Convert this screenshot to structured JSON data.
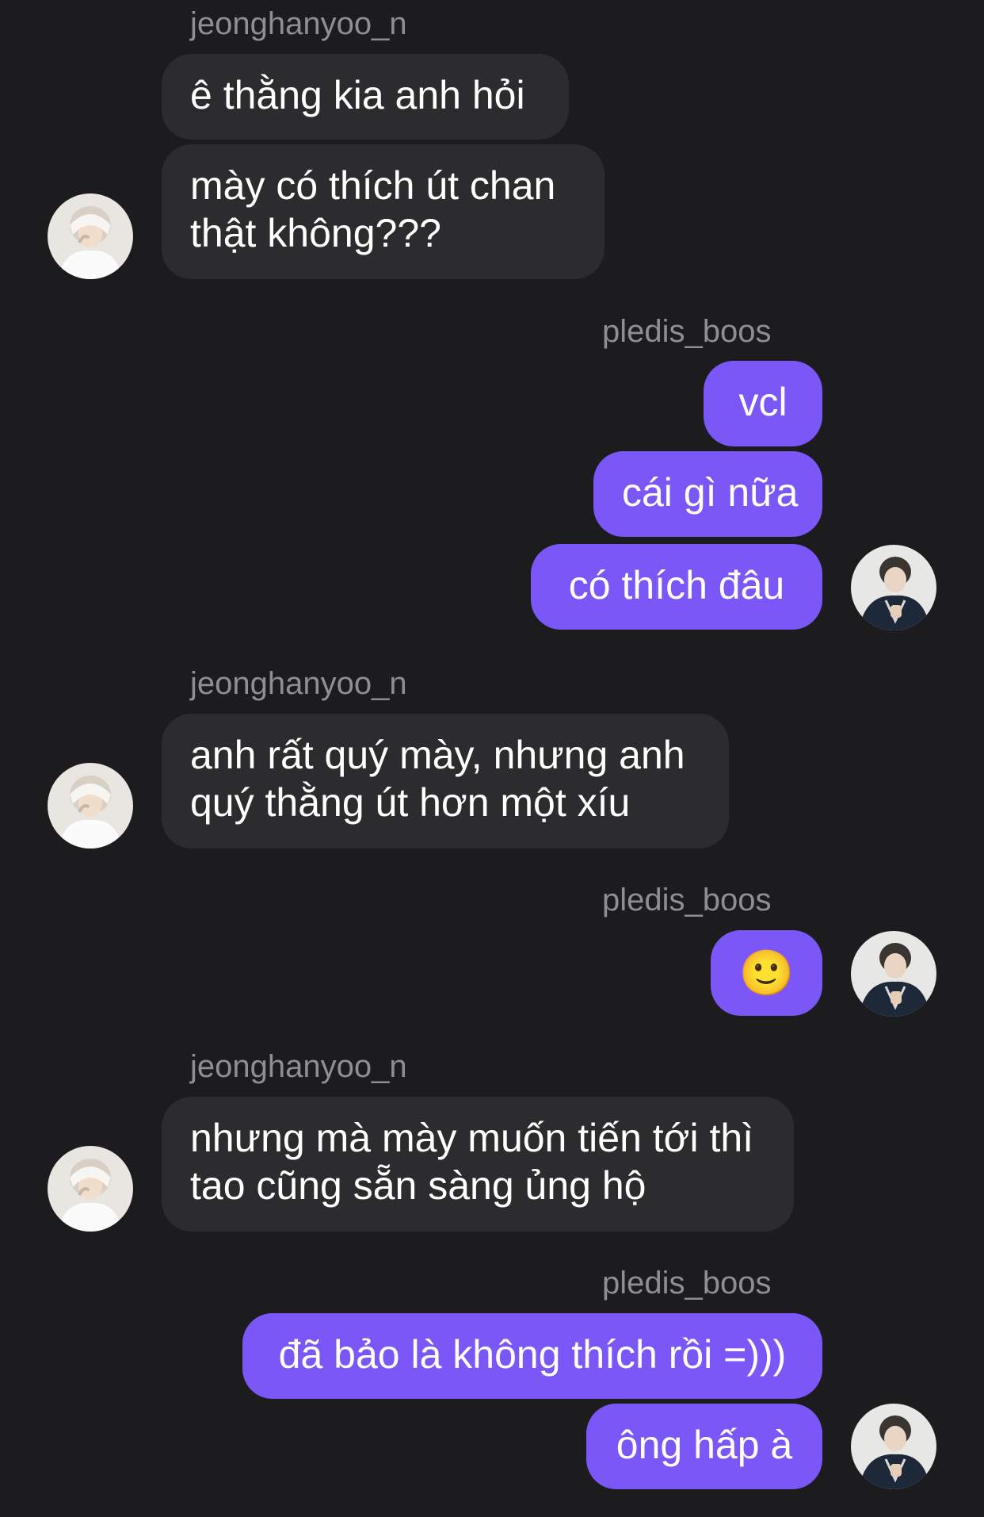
{
  "participants": {
    "other": {
      "username": "jeonghanyoo_n",
      "avatar_icon": "avatar-white-hood-person-icon"
    },
    "self": {
      "username": "pledis_boos",
      "avatar_icon": "avatar-dark-jacket-person-icon"
    }
  },
  "groups": [
    {
      "sender": "jeonghanyoo_n",
      "messages": [
        {
          "text": "ê thằng kia anh hỏi"
        },
        {
          "lines": [
            "mày có thích út chan",
            "thật không???"
          ]
        }
      ]
    },
    {
      "sender": "pledis_boos",
      "messages": [
        {
          "text": "vcl"
        },
        {
          "text": "cái gì nữa"
        },
        {
          "text": "có thích đâu"
        }
      ]
    },
    {
      "sender": "jeonghanyoo_n",
      "messages": [
        {
          "lines": [
            "anh rất quý mày, nhưng anh",
            "quý thằng út hơn một xíu"
          ]
        }
      ]
    },
    {
      "sender": "pledis_boos",
      "messages": [
        {
          "emoji": "🙂",
          "emoji_name": "slightly-smiling-face-emoji"
        }
      ]
    },
    {
      "sender": "jeonghanyoo_n",
      "messages": [
        {
          "lines": [
            "nhưng mà mày muốn tiến tới thì",
            "tao cũng sẵn sàng ủng hộ"
          ]
        }
      ]
    },
    {
      "sender": "pledis_boos",
      "messages": [
        {
          "text": "đã bảo là không thích rồi =)))"
        },
        {
          "text": "ông hấp à"
        }
      ]
    }
  ],
  "colors": {
    "background": "#1c1c1e",
    "incoming_bubble": "#2c2c2e",
    "outgoing_bubble": "#7b57f7",
    "username": "#8e8e93"
  }
}
